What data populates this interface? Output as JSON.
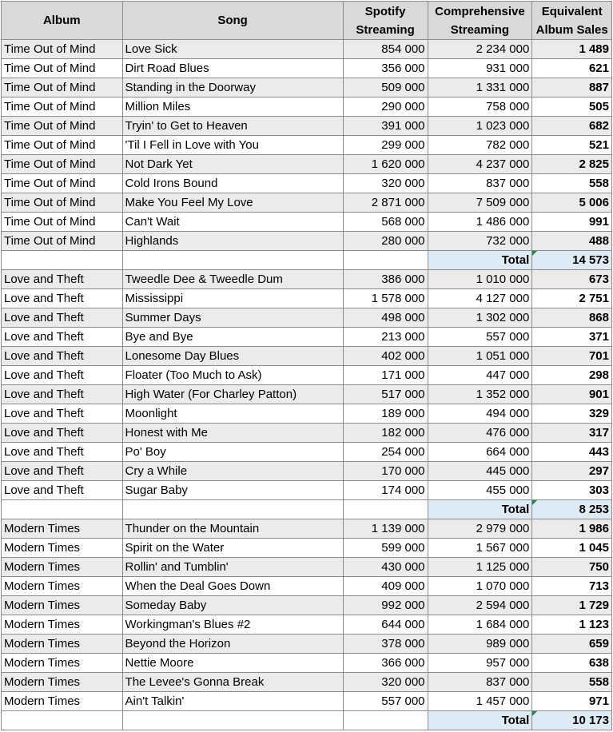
{
  "headers": {
    "album": "Album",
    "song": "Song",
    "spotify_line1": "Spotify",
    "spotify_line2": "Streaming",
    "comp_line1": "Comprehensive",
    "comp_line2": "Streaming",
    "eas_line1": "Equivalent",
    "eas_line2": "Album Sales"
  },
  "total_label": "Total",
  "albums": [
    {
      "name": "Time Out of Mind",
      "total": "14 573",
      "rows": [
        {
          "song": "Love Sick",
          "spotify": "854 000",
          "comp": "2 234 000",
          "eas": "1 489"
        },
        {
          "song": "Dirt Road Blues",
          "spotify": "356 000",
          "comp": "931 000",
          "eas": "621"
        },
        {
          "song": "Standing in the Doorway",
          "spotify": "509 000",
          "comp": "1 331 000",
          "eas": "887"
        },
        {
          "song": "Million Miles",
          "spotify": "290 000",
          "comp": "758 000",
          "eas": "505"
        },
        {
          "song": "Tryin' to Get to Heaven",
          "spotify": "391 000",
          "comp": "1 023 000",
          "eas": "682"
        },
        {
          "song": "'Til I Fell in Love with You",
          "spotify": "299 000",
          "comp": "782 000",
          "eas": "521"
        },
        {
          "song": "Not Dark Yet",
          "spotify": "1 620 000",
          "comp": "4 237 000",
          "eas": "2 825"
        },
        {
          "song": "Cold Irons Bound",
          "spotify": "320 000",
          "comp": "837 000",
          "eas": "558"
        },
        {
          "song": "Make You Feel My Love",
          "spotify": "2 871 000",
          "comp": "7 509 000",
          "eas": "5 006"
        },
        {
          "song": "Can't Wait",
          "spotify": "568 000",
          "comp": "1 486 000",
          "eas": "991"
        },
        {
          "song": "Highlands",
          "spotify": "280 000",
          "comp": "732 000",
          "eas": "488"
        }
      ]
    },
    {
      "name": "Love and Theft",
      "total": "8 253",
      "rows": [
        {
          "song": "Tweedle Dee & Tweedle Dum",
          "spotify": "386 000",
          "comp": "1 010 000",
          "eas": "673"
        },
        {
          "song": "Mississippi",
          "spotify": "1 578 000",
          "comp": "4 127 000",
          "eas": "2 751"
        },
        {
          "song": "Summer Days",
          "spotify": "498 000",
          "comp": "1 302 000",
          "eas": "868"
        },
        {
          "song": "Bye and Bye",
          "spotify": "213 000",
          "comp": "557 000",
          "eas": "371"
        },
        {
          "song": "Lonesome Day Blues",
          "spotify": "402 000",
          "comp": "1 051 000",
          "eas": "701"
        },
        {
          "song": "Floater (Too Much to Ask)",
          "spotify": "171 000",
          "comp": "447 000",
          "eas": "298"
        },
        {
          "song": "High Water (For Charley Patton)",
          "spotify": "517 000",
          "comp": "1 352 000",
          "eas": "901"
        },
        {
          "song": "Moonlight",
          "spotify": "189 000",
          "comp": "494 000",
          "eas": "329"
        },
        {
          "song": "Honest with Me",
          "spotify": "182 000",
          "comp": "476 000",
          "eas": "317"
        },
        {
          "song": "Po' Boy",
          "spotify": "254 000",
          "comp": "664 000",
          "eas": "443"
        },
        {
          "song": "Cry a While",
          "spotify": "170 000",
          "comp": "445 000",
          "eas": "297"
        },
        {
          "song": "Sugar Baby",
          "spotify": "174 000",
          "comp": "455 000",
          "eas": "303"
        }
      ]
    },
    {
      "name": "Modern Times",
      "total": "10 173",
      "rows": [
        {
          "song": "Thunder on the Mountain",
          "spotify": "1 139 000",
          "comp": "2 979 000",
          "eas": "1 986"
        },
        {
          "song": "Spirit on the Water",
          "spotify": "599 000",
          "comp": "1 567 000",
          "eas": "1 045"
        },
        {
          "song": "Rollin' and Tumblin'",
          "spotify": "430 000",
          "comp": "1 125 000",
          "eas": "750"
        },
        {
          "song": "When the Deal Goes Down",
          "spotify": "409 000",
          "comp": "1 070 000",
          "eas": "713"
        },
        {
          "song": "Someday Baby",
          "spotify": "992 000",
          "comp": "2 594 000",
          "eas": "1 729"
        },
        {
          "song": "Workingman's Blues #2",
          "spotify": "644 000",
          "comp": "1 684 000",
          "eas": "1 123"
        },
        {
          "song": "Beyond the Horizon",
          "spotify": "378 000",
          "comp": "989 000",
          "eas": "659"
        },
        {
          "song": "Nettie Moore",
          "spotify": "366 000",
          "comp": "957 000",
          "eas": "638"
        },
        {
          "song": "The Levee's Gonna Break",
          "spotify": "320 000",
          "comp": "837 000",
          "eas": "558"
        },
        {
          "song": "Ain't Talkin'",
          "spotify": "557 000",
          "comp": "1 457 000",
          "eas": "971"
        }
      ]
    }
  ]
}
